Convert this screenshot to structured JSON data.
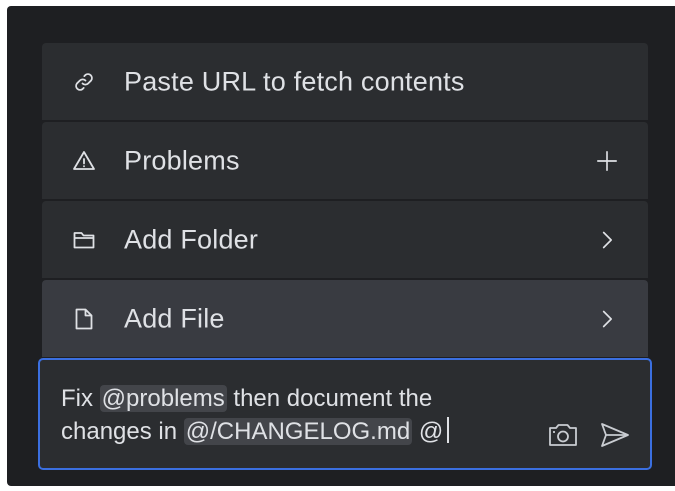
{
  "menu": {
    "items": [
      {
        "label": "Paste URL to fetch contents",
        "icon": "link-icon"
      },
      {
        "label": "Problems",
        "icon": "warning-icon",
        "trailing": "plus-icon"
      },
      {
        "label": "Add Folder",
        "icon": "folder-icon",
        "trailing": "chevron-right-icon"
      },
      {
        "label": "Add File",
        "icon": "file-icon",
        "trailing": "chevron-right-icon",
        "selected": true
      }
    ]
  },
  "input": {
    "line1_prefix": "Fix ",
    "mention_problems": "@problems",
    "line1_suffix": " then document the",
    "line2_prefix": "changes in ",
    "mention_changelog": "@/CHANGELOG.md",
    "line2_suffix": " @"
  },
  "actions": {
    "screenshot_icon": "camera-icon",
    "send_icon": "send-icon"
  },
  "colors": {
    "background": "#1e1f22",
    "item": "#2b2d30",
    "item_selected": "#393b41",
    "focus_border": "#3b6fe0",
    "text": "#dfe1e5"
  }
}
